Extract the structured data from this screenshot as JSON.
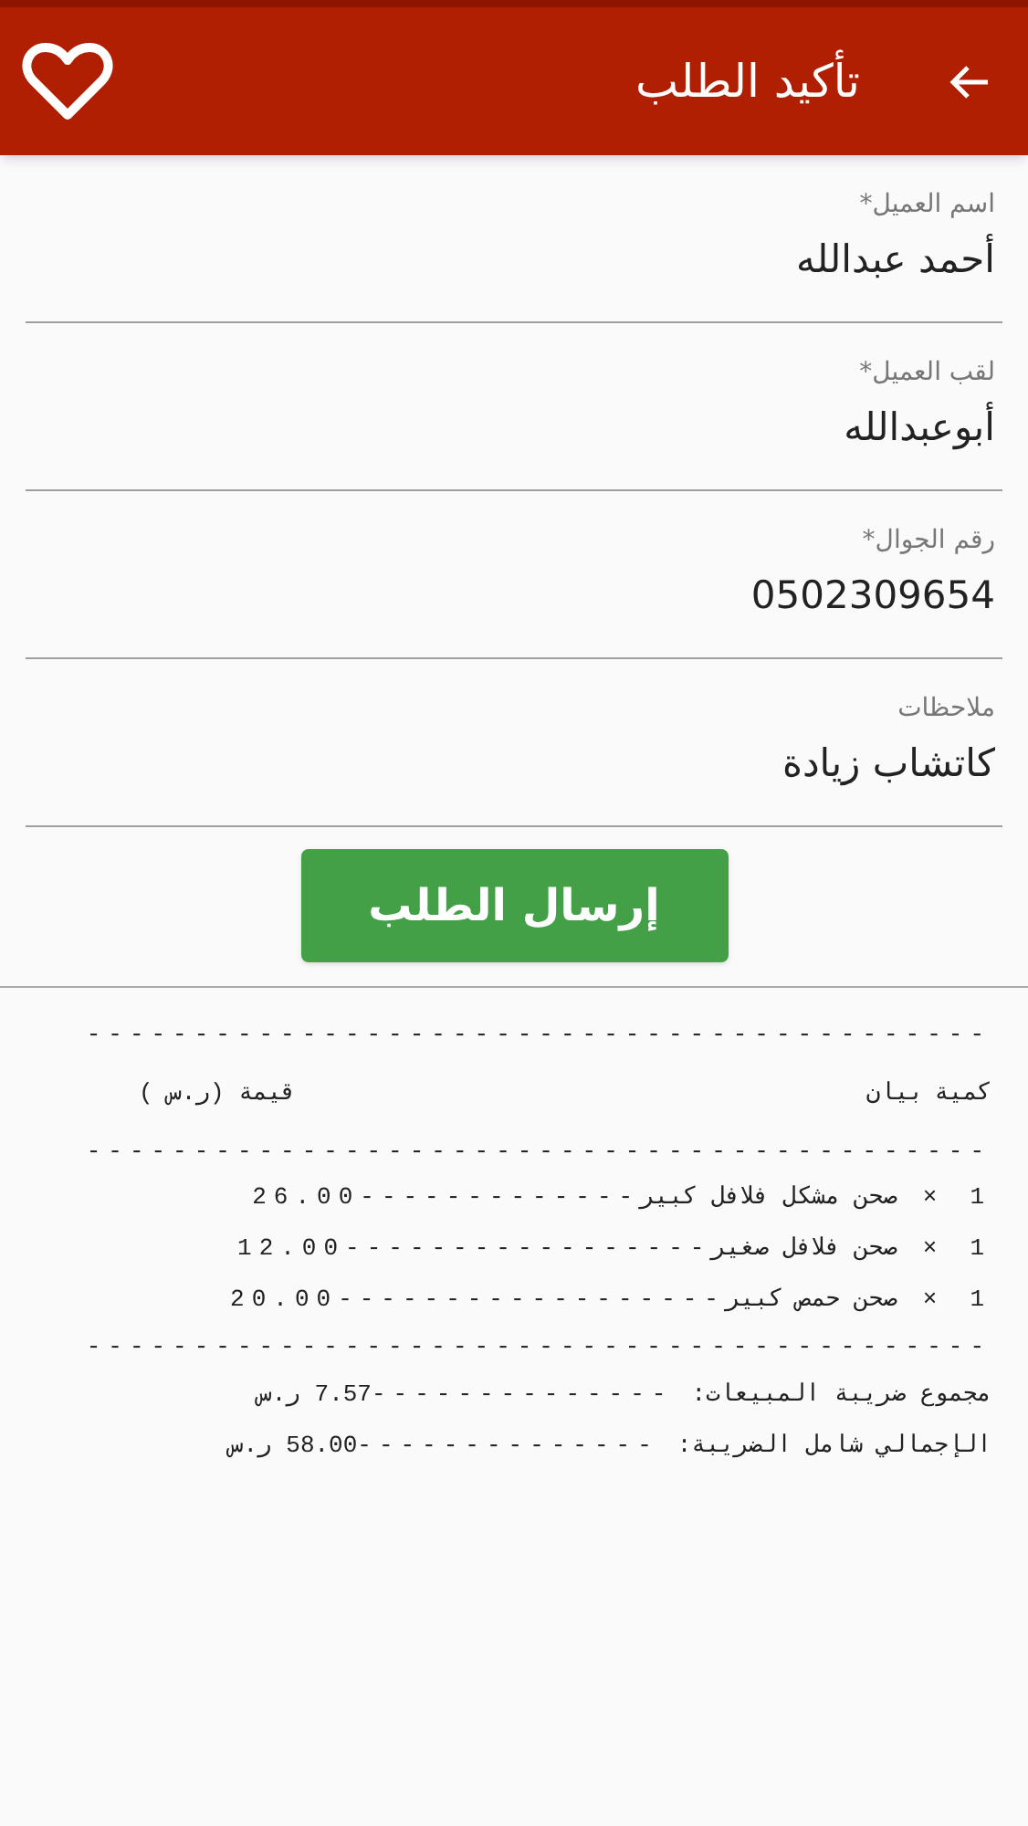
{
  "header": {
    "title": "تأكيد الطلب"
  },
  "fields": [
    {
      "label": "اسم العميل*",
      "value": "أحمد عبدالله"
    },
    {
      "label": "لقب العميل*",
      "value": "أبوعبدالله"
    },
    {
      "label": "رقم الجوال*",
      "value": "0502309654"
    },
    {
      "label": "ملاحظات",
      "value": "كاتشاب زيادة"
    }
  ],
  "submit_button": "إرسال الطلب",
  "receipt": {
    "separator": "------------------------------------------",
    "columns": {
      "quantity": "كمية",
      "description": "بيان",
      "price": "قيمة (ر.س )"
    },
    "items": [
      {
        "quantity": "1",
        "times": "×",
        "name": "صحن مشكل فلافل كبير",
        "dashes": "-------------",
        "price": "26.00"
      },
      {
        "quantity": "1",
        "times": "×",
        "name": "صحن فلافل صغير",
        "dashes": "-----------------",
        "price": "12.00"
      },
      {
        "quantity": "1",
        "times": "×",
        "name": "صحن حمص كبير",
        "dashes": "------------------",
        "price": "20.00"
      }
    ],
    "totals": [
      {
        "label": "مجموع ضريبة المبيعات:",
        "dashes": "--------------",
        "value": "7.57 ر.س"
      },
      {
        "label": "الإجمالي شامل الضريبة:",
        "dashes": "--------------",
        "value": "58.00 ر.س"
      }
    ]
  }
}
